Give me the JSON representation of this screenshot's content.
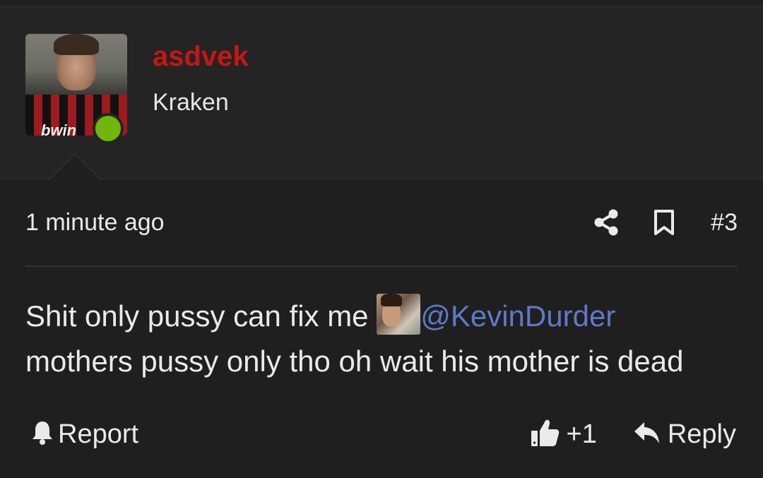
{
  "post": {
    "author": {
      "username": "asdvek",
      "user_title": "Kraken",
      "avatar_text": "bwin",
      "online": true
    },
    "timestamp": "1 minute ago",
    "post_number": "#3",
    "message": {
      "part1": "Shit only pussy can fix me",
      "mention": "@KevinDurder",
      "part2": "mothers pussy only tho oh wait his mother is dead"
    },
    "actions": {
      "report_label": "Report",
      "like_count": "+1",
      "reply_label": "Reply"
    }
  },
  "colors": {
    "background": "#1f1f1f",
    "header_bg": "#242424",
    "username": "#c41616",
    "mention": "#5f79c8",
    "online_dot": "#6fb60d"
  },
  "icons": [
    "share-icon",
    "bookmark-icon",
    "bell-icon",
    "thumbs-up-icon",
    "reply-icon"
  ]
}
